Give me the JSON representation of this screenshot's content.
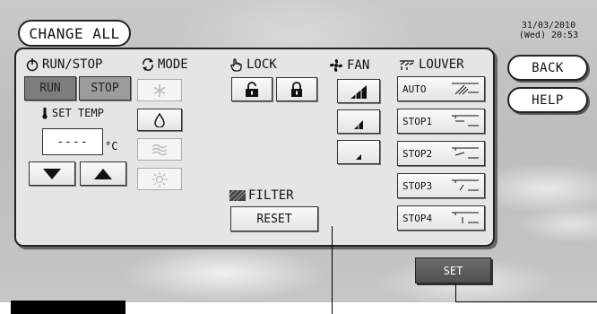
{
  "header": {
    "change_all": "CHANGE ALL",
    "date": "31/03/2010",
    "day_time": "(Wed) 20:53"
  },
  "side": {
    "back": "BACK",
    "help": "HELP"
  },
  "run_stop": {
    "title": "RUN/STOP",
    "run": "RUN",
    "stop": "STOP"
  },
  "set_temp": {
    "title": "SET TEMP",
    "value": "----",
    "unit": "°C"
  },
  "mode": {
    "title": "MODE",
    "items": [
      "cool-icon",
      "dry-icon",
      "fan-mode-icon",
      "heat-icon"
    ],
    "enabled": [
      false,
      true,
      false,
      false
    ]
  },
  "lock": {
    "title": "LOCK",
    "icons": [
      "unlock-icon",
      "lock-icon"
    ]
  },
  "fan": {
    "title": "FAN",
    "levels": [
      "high",
      "medium",
      "low"
    ]
  },
  "louver": {
    "title": "LOUVER",
    "items": [
      "AUTO",
      "STOP1",
      "STOP2",
      "STOP3",
      "STOP4"
    ]
  },
  "filter": {
    "title": "FILTER",
    "reset": "RESET"
  },
  "footer": {
    "set": "SET"
  },
  "colors": {
    "run_bg": "#7d7d7d",
    "stop_bg": "#9c9c9c",
    "set_bg": "#5a5a5a",
    "panel": "#e5e5e5"
  }
}
